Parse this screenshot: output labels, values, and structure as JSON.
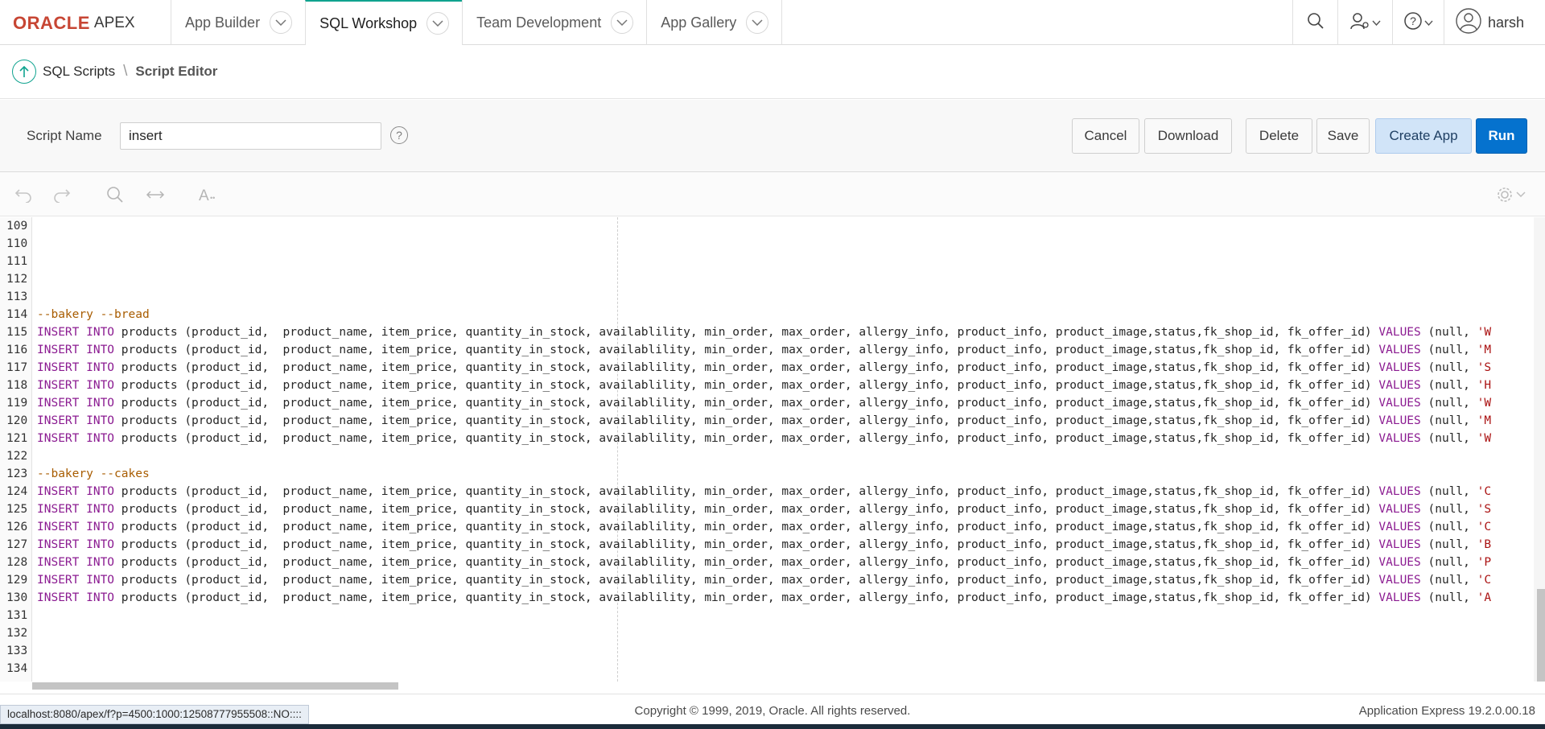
{
  "app": {
    "brand": "ORACLE",
    "product": "APEX"
  },
  "nav": {
    "tabs": [
      {
        "label": "App Builder"
      },
      {
        "label": "SQL Workshop"
      },
      {
        "label": "Team Development"
      },
      {
        "label": "App Gallery"
      }
    ],
    "user": "harsh"
  },
  "breadcrumb": {
    "parent": "SQL Scripts",
    "separator": "\\",
    "current": "Script Editor"
  },
  "script": {
    "name_label": "Script Name",
    "name_value": "insert",
    "help_symbol": "?"
  },
  "buttons": {
    "cancel": "Cancel",
    "download": "Download",
    "delete": "Delete",
    "save": "Save",
    "create_app": "Create App",
    "run": "Run"
  },
  "editor": {
    "lines": [
      {
        "n": "109",
        "type": "blank"
      },
      {
        "n": "110",
        "type": "blank"
      },
      {
        "n": "111",
        "type": "blank"
      },
      {
        "n": "112",
        "type": "blank"
      },
      {
        "n": "113",
        "type": "blank"
      },
      {
        "n": "114",
        "type": "comment",
        "text": "--bakery --bread"
      },
      {
        "n": "115",
        "type": "insert",
        "val": "'W"
      },
      {
        "n": "116",
        "type": "insert",
        "val": "'M"
      },
      {
        "n": "117",
        "type": "insert",
        "val": "'S"
      },
      {
        "n": "118",
        "type": "insert",
        "val": "'H"
      },
      {
        "n": "119",
        "type": "insert",
        "val": "'W"
      },
      {
        "n": "120",
        "type": "insert",
        "val": "'M"
      },
      {
        "n": "121",
        "type": "insert",
        "val": "'W"
      },
      {
        "n": "122",
        "type": "blank"
      },
      {
        "n": "123",
        "type": "comment",
        "text": "--bakery --cakes"
      },
      {
        "n": "124",
        "type": "insert",
        "val": "'C"
      },
      {
        "n": "125",
        "type": "insert",
        "val": "'S"
      },
      {
        "n": "126",
        "type": "insert",
        "val": "'C"
      },
      {
        "n": "127",
        "type": "insert",
        "val": "'B"
      },
      {
        "n": "128",
        "type": "insert",
        "val": "'P"
      },
      {
        "n": "129",
        "type": "insert",
        "val": "'C"
      },
      {
        "n": "130",
        "type": "insert",
        "val": "'A"
      },
      {
        "n": "131",
        "type": "blank"
      },
      {
        "n": "132",
        "type": "blank"
      },
      {
        "n": "133",
        "type": "blank"
      },
      {
        "n": "134",
        "type": "blank"
      }
    ],
    "insert_kw": "INSERT INTO",
    "insert_cols": " products (product_id,  product_name, item_price, quantity_in_stock, availablility, min_order, max_order, allergy_info, product_info, product_image,status,fk_shop_id, fk_offer_id) ",
    "values_kw": "VALUES",
    "values_prefix": " (null, "
  },
  "footer": {
    "copyright": "Copyright © 1999, 2019, Oracle. All rights reserved.",
    "version": "Application Express 19.2.0.00.18",
    "status_url": "localhost:8080/apex/f?p=4500:1000:12508777955508::NO::::"
  },
  "colors": {
    "accent": "#0fa38f",
    "oracle_red": "#c74634",
    "run_blue": "#0572ce",
    "create_app_bg": "#d1e4f8"
  }
}
